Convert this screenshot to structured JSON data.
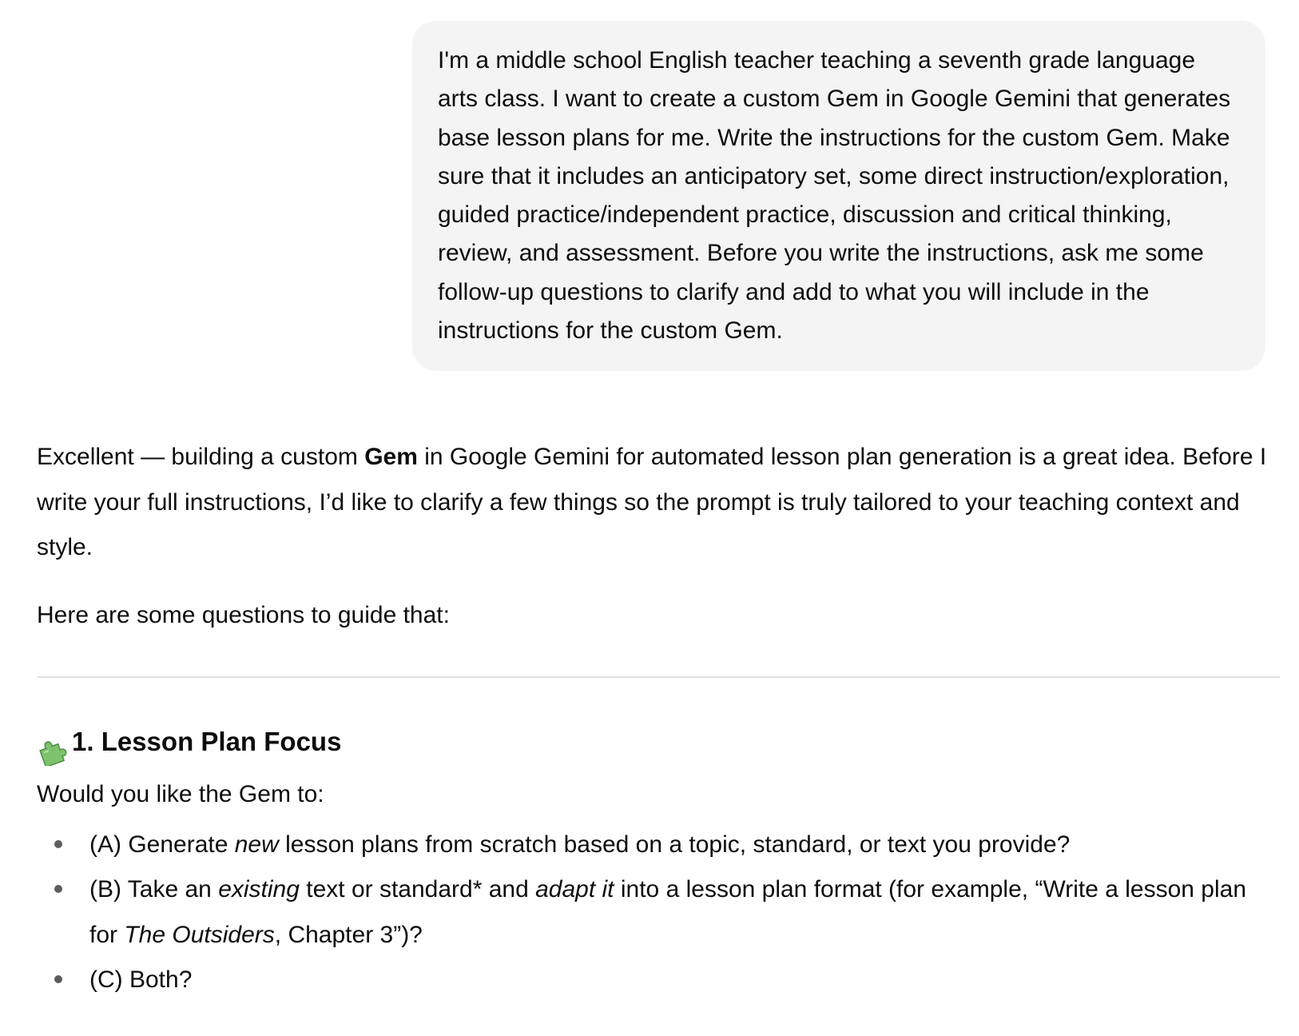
{
  "user_message": {
    "text": "I'm a middle school English teacher teaching a seventh grade language arts class. I want to create a custom Gem in Google Gemini that generates base lesson plans for me. Write the instructions for the custom Gem. Make sure that it includes an anticipatory set, some direct instruction/exploration, guided practice/independent practice, discussion and critical thinking, review, and assessment. Before you write the instructions, ask me some follow-up questions to clarify and add to what you will include in the instructions for the custom Gem."
  },
  "assistant": {
    "para1": {
      "before": "Excellent — building a custom ",
      "bold": "Gem",
      "after": " in Google Gemini for automated lesson plan generation is a great idea. Before I write your full instructions, I’d like to clarify a few things so the prompt is truly tailored to your teaching context and style."
    },
    "para2": "Here are some questions to guide that:",
    "section": {
      "icon": "puzzle-piece-icon",
      "heading": "1. Lesson Plan Focus",
      "intro": "Would you like the Gem to:",
      "options": [
        {
          "a": "(A) Generate ",
          "a_em": "new",
          "a_rest": " lesson plans from scratch based on a topic, standard, or text you provide?"
        },
        {
          "b1": "(B) Take an ",
          "b_em1": "existing",
          "b2": " text or standard* and ",
          "b_em2": "adapt it",
          "b3": " into a lesson plan format (for example, “Write a lesson plan for ",
          "b_em3": "The Outsiders",
          "b4": ", Chapter 3”)?"
        },
        {
          "c": "(C) Both?"
        }
      ]
    }
  }
}
